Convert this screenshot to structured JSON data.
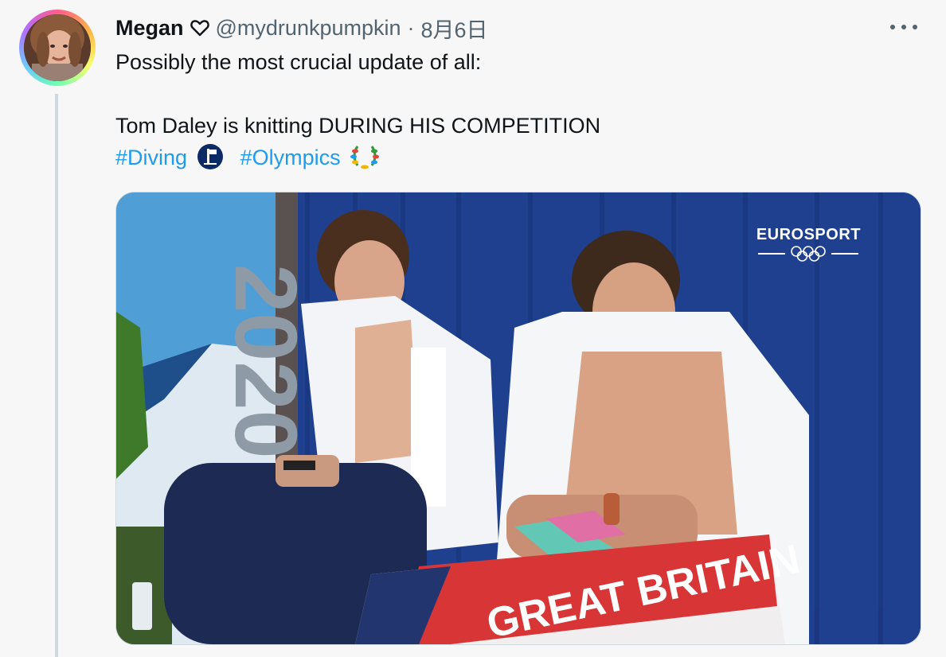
{
  "tweet": {
    "author_name": "Megan",
    "author_handle": "@mydrunkpumpkin",
    "separator": "·",
    "date": "8月6日",
    "lines": [
      "Possibly the most crucial update of all:",
      "Tom Daley is knitting DURING HIS COMPETITION"
    ],
    "hashtags": [
      "#Diving",
      "#Olympics"
    ]
  },
  "media": {
    "watermark": "EUROSPORT",
    "sign_text": "2020",
    "towel_text": "GREAT BRITAIN"
  },
  "icons": {
    "heart": "heart-outline-icon",
    "more": "more-horizontal-icon",
    "diving": "diving-emoji-icon",
    "olympics": "laurel-wreath-emoji-icon"
  },
  "colors": {
    "hashtag": "#1d9bf0",
    "secondary_text": "#536471",
    "thread_line": "#cfd9de"
  }
}
